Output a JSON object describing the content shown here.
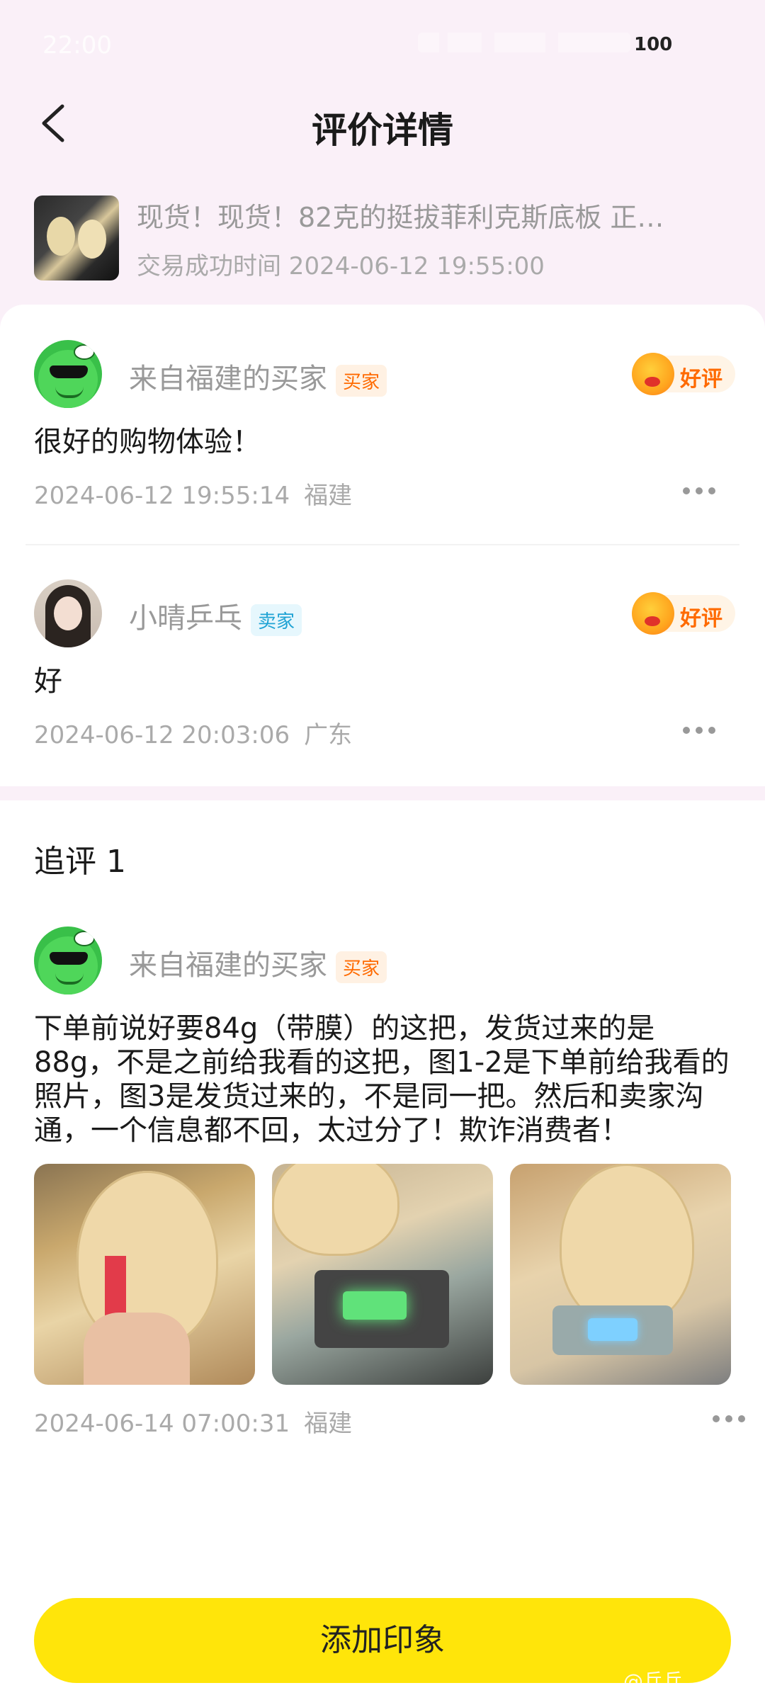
{
  "status_bar": {
    "time": "22:00",
    "battery": "100"
  },
  "nav": {
    "title": "评价详情"
  },
  "product": {
    "title": "现货！现货！82克的挺拔菲利克斯底板 正…",
    "trade_time": "交易成功时间 2024-06-12 19:55:00"
  },
  "reviews": [
    {
      "user": "来自福建的买家",
      "role": "买家",
      "rating": "好评",
      "content": "很好的购物体验！",
      "date": "2024-06-12 19:55:14",
      "location": "福建"
    },
    {
      "user": "小晴乒乓",
      "role": "卖家",
      "rating": "好评",
      "content": "好",
      "date": "2024-06-12 20:03:06",
      "location": "广东"
    }
  ],
  "followup": {
    "section_title": "追评 1",
    "user": "来自福建的买家",
    "role": "买家",
    "content": "下单前说好要84g（带膜）的这把，发货过来的是88g，不是之前给我看的这把，图1-2是下单前给我看的照片，图3是发货过来的，不是同一把。然后和卖家沟通，一个信息都不回，太过分了！欺诈消费者！",
    "date": "2024-06-14 07:00:31",
    "location": "福建"
  },
  "bottom_button": {
    "label": "添加印象"
  },
  "watermark": "@乒乓"
}
